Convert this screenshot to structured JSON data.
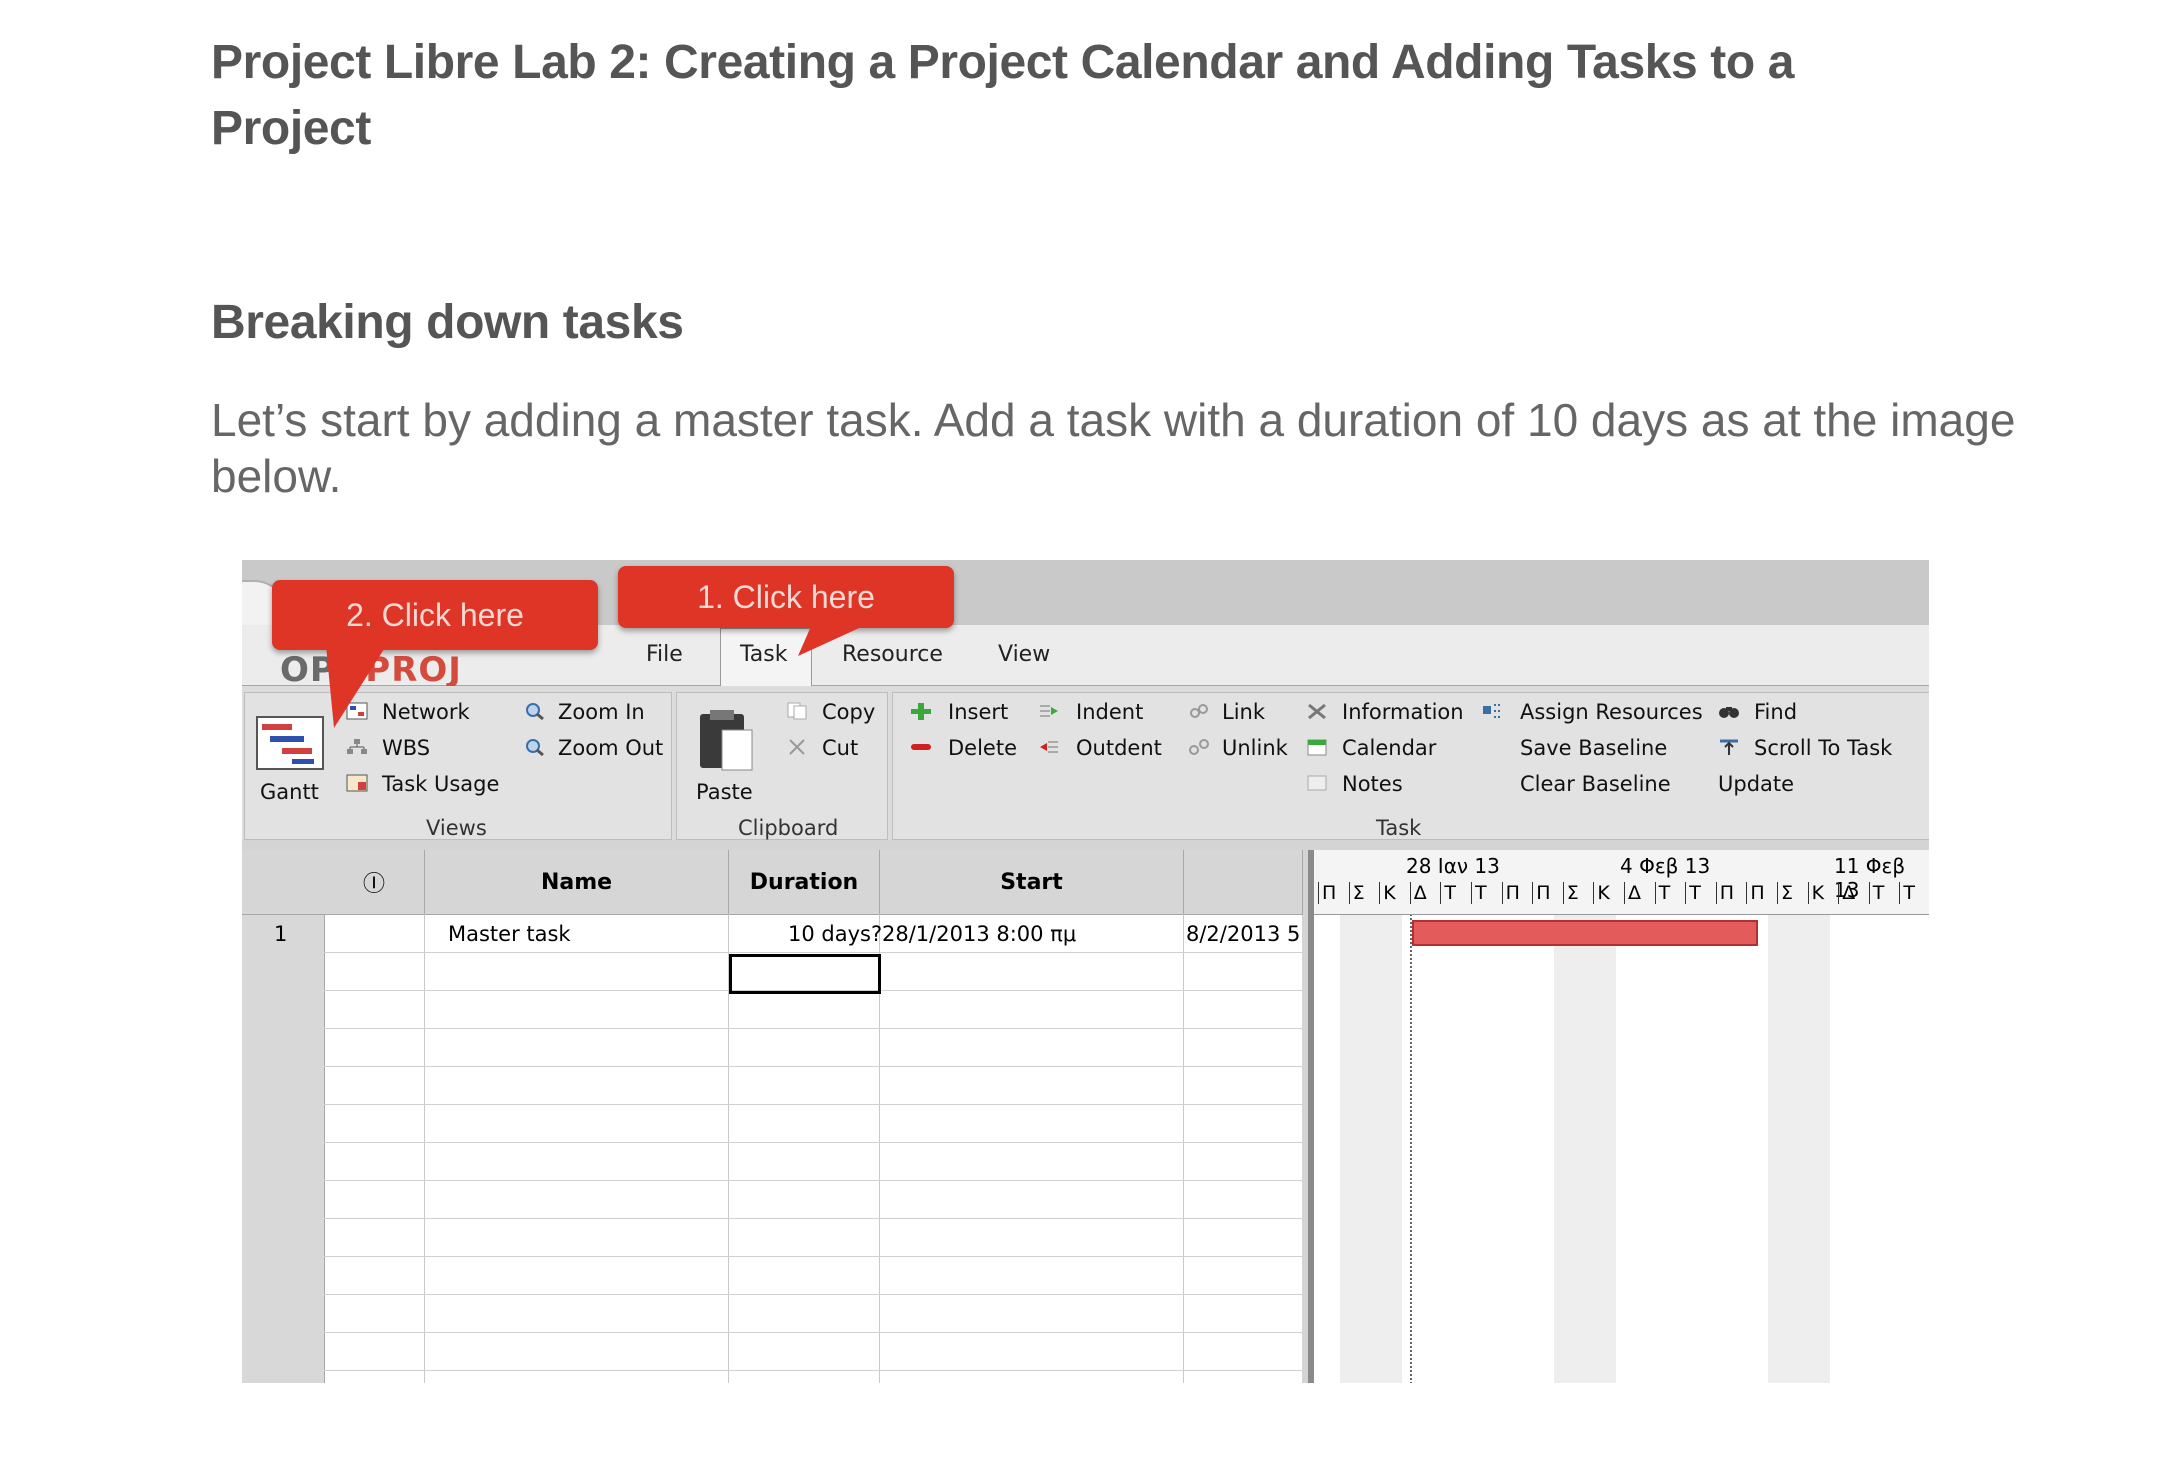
{
  "doc": {
    "title": "Project Libre Lab 2: Creating a Project Calendar and Adding Tasks to a Project",
    "section": "Breaking down tasks",
    "paragraph": "Let’s start by adding a master task.  Add a task with a duration of 10 days as at the image below."
  },
  "screenshot": {
    "callouts": {
      "c1": "1. Click here",
      "c2": "2. Click here"
    },
    "logo": {
      "part1": "OP",
      "part2": "NPROJ"
    },
    "tabs": {
      "file": "File",
      "task": "Task",
      "resource": "Resource",
      "view": "View"
    },
    "views": {
      "gantt": "Gantt",
      "network": "Network",
      "wbs": "WBS",
      "task_usage": "Task Usage",
      "zoom_in": "Zoom In",
      "zoom_out": "Zoom Out",
      "group": "Views"
    },
    "clipboard": {
      "paste": "Paste",
      "copy": "Copy",
      "cut": "Cut",
      "group": "Clipboard"
    },
    "task": {
      "insert": "Insert",
      "delete": "Delete",
      "indent": "Indent",
      "outdent": "Outdent",
      "link": "Link",
      "unlink": "Unlink",
      "information": "Information",
      "calendar": "Calendar",
      "notes": "Notes",
      "assign_resources": "Assign Resources",
      "save_baseline": "Save Baseline",
      "clear_baseline": "Clear Baseline",
      "find": "Find",
      "scroll_to_task": "Scroll To Task",
      "update": "Update",
      "group": "Task"
    },
    "table": {
      "headers": {
        "indicator": "Ⓘ",
        "name": "Name",
        "duration": "Duration",
        "start": "Start"
      },
      "rows": [
        {
          "id": "1",
          "name": "Master task",
          "duration": "10 days?",
          "start": "28/1/2013 8:00 πμ",
          "finish": "8/2/2013 5"
        }
      ]
    },
    "gantt": {
      "dates": [
        "28 Ιαν 13",
        "4 Φεβ 13",
        "11 Φεβ 13"
      ],
      "days": [
        "Π",
        "Σ",
        "Κ",
        "Δ",
        "Τ",
        "Τ",
        "Π",
        "Π",
        "Σ",
        "Κ",
        "Δ",
        "Τ",
        "Τ",
        "Π",
        "Π",
        "Σ",
        "Κ",
        "Δ",
        "Τ",
        "Τ"
      ],
      "bar_color": "#e35b5b"
    }
  }
}
